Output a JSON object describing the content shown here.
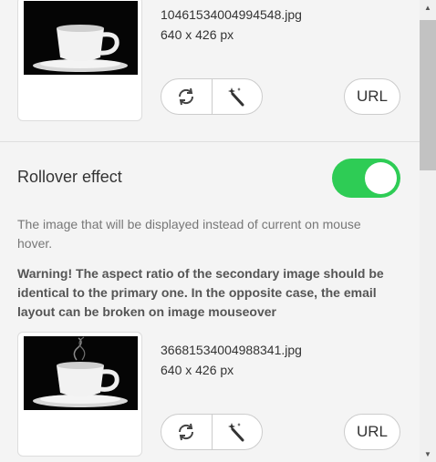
{
  "image1": {
    "file_name": "10461534004994548.jpg",
    "dimensions": "640 x 426 px",
    "refresh_icon": "refresh-icon",
    "magic_icon": "magic-wand-icon",
    "url_label": "URL"
  },
  "rollover": {
    "label": "Rollover effect",
    "enabled": true,
    "toggle_color": "#2ecc55",
    "description": "The image that will be displayed instead of current on mouse hover.",
    "warning": "Warning! The aspect ratio of the secondary image should be identical to the primary one. In the opposite case, the email layout can be broken on image mouseover"
  },
  "image2": {
    "file_name": "36681534004988341.jpg",
    "dimensions": "640 x 426 px",
    "refresh_icon": "refresh-icon",
    "magic_icon": "magic-wand-icon",
    "url_label": "URL"
  }
}
